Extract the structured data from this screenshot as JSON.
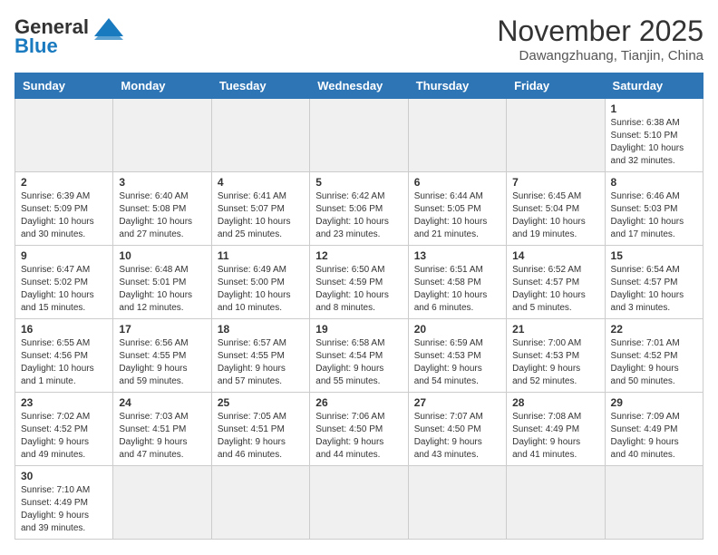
{
  "header": {
    "logo_general": "General",
    "logo_blue": "Blue",
    "month": "November 2025",
    "location": "Dawangzhuang, Tianjin, China"
  },
  "weekdays": [
    "Sunday",
    "Monday",
    "Tuesday",
    "Wednesday",
    "Thursday",
    "Friday",
    "Saturday"
  ],
  "weeks": [
    [
      {
        "day": "",
        "info": ""
      },
      {
        "day": "",
        "info": ""
      },
      {
        "day": "",
        "info": ""
      },
      {
        "day": "",
        "info": ""
      },
      {
        "day": "",
        "info": ""
      },
      {
        "day": "",
        "info": ""
      },
      {
        "day": "1",
        "info": "Sunrise: 6:38 AM\nSunset: 5:10 PM\nDaylight: 10 hours\nand 32 minutes."
      }
    ],
    [
      {
        "day": "2",
        "info": "Sunrise: 6:39 AM\nSunset: 5:09 PM\nDaylight: 10 hours\nand 30 minutes."
      },
      {
        "day": "3",
        "info": "Sunrise: 6:40 AM\nSunset: 5:08 PM\nDaylight: 10 hours\nand 27 minutes."
      },
      {
        "day": "4",
        "info": "Sunrise: 6:41 AM\nSunset: 5:07 PM\nDaylight: 10 hours\nand 25 minutes."
      },
      {
        "day": "5",
        "info": "Sunrise: 6:42 AM\nSunset: 5:06 PM\nDaylight: 10 hours\nand 23 minutes."
      },
      {
        "day": "6",
        "info": "Sunrise: 6:44 AM\nSunset: 5:05 PM\nDaylight: 10 hours\nand 21 minutes."
      },
      {
        "day": "7",
        "info": "Sunrise: 6:45 AM\nSunset: 5:04 PM\nDaylight: 10 hours\nand 19 minutes."
      },
      {
        "day": "8",
        "info": "Sunrise: 6:46 AM\nSunset: 5:03 PM\nDaylight: 10 hours\nand 17 minutes."
      }
    ],
    [
      {
        "day": "9",
        "info": "Sunrise: 6:47 AM\nSunset: 5:02 PM\nDaylight: 10 hours\nand 15 minutes."
      },
      {
        "day": "10",
        "info": "Sunrise: 6:48 AM\nSunset: 5:01 PM\nDaylight: 10 hours\nand 12 minutes."
      },
      {
        "day": "11",
        "info": "Sunrise: 6:49 AM\nSunset: 5:00 PM\nDaylight: 10 hours\nand 10 minutes."
      },
      {
        "day": "12",
        "info": "Sunrise: 6:50 AM\nSunset: 4:59 PM\nDaylight: 10 hours\nand 8 minutes."
      },
      {
        "day": "13",
        "info": "Sunrise: 6:51 AM\nSunset: 4:58 PM\nDaylight: 10 hours\nand 6 minutes."
      },
      {
        "day": "14",
        "info": "Sunrise: 6:52 AM\nSunset: 4:57 PM\nDaylight: 10 hours\nand 5 minutes."
      },
      {
        "day": "15",
        "info": "Sunrise: 6:54 AM\nSunset: 4:57 PM\nDaylight: 10 hours\nand 3 minutes."
      }
    ],
    [
      {
        "day": "16",
        "info": "Sunrise: 6:55 AM\nSunset: 4:56 PM\nDaylight: 10 hours\nand 1 minute."
      },
      {
        "day": "17",
        "info": "Sunrise: 6:56 AM\nSunset: 4:55 PM\nDaylight: 9 hours\nand 59 minutes."
      },
      {
        "day": "18",
        "info": "Sunrise: 6:57 AM\nSunset: 4:55 PM\nDaylight: 9 hours\nand 57 minutes."
      },
      {
        "day": "19",
        "info": "Sunrise: 6:58 AM\nSunset: 4:54 PM\nDaylight: 9 hours\nand 55 minutes."
      },
      {
        "day": "20",
        "info": "Sunrise: 6:59 AM\nSunset: 4:53 PM\nDaylight: 9 hours\nand 54 minutes."
      },
      {
        "day": "21",
        "info": "Sunrise: 7:00 AM\nSunset: 4:53 PM\nDaylight: 9 hours\nand 52 minutes."
      },
      {
        "day": "22",
        "info": "Sunrise: 7:01 AM\nSunset: 4:52 PM\nDaylight: 9 hours\nand 50 minutes."
      }
    ],
    [
      {
        "day": "23",
        "info": "Sunrise: 7:02 AM\nSunset: 4:52 PM\nDaylight: 9 hours\nand 49 minutes."
      },
      {
        "day": "24",
        "info": "Sunrise: 7:03 AM\nSunset: 4:51 PM\nDaylight: 9 hours\nand 47 minutes."
      },
      {
        "day": "25",
        "info": "Sunrise: 7:05 AM\nSunset: 4:51 PM\nDaylight: 9 hours\nand 46 minutes."
      },
      {
        "day": "26",
        "info": "Sunrise: 7:06 AM\nSunset: 4:50 PM\nDaylight: 9 hours\nand 44 minutes."
      },
      {
        "day": "27",
        "info": "Sunrise: 7:07 AM\nSunset: 4:50 PM\nDaylight: 9 hours\nand 43 minutes."
      },
      {
        "day": "28",
        "info": "Sunrise: 7:08 AM\nSunset: 4:49 PM\nDaylight: 9 hours\nand 41 minutes."
      },
      {
        "day": "29",
        "info": "Sunrise: 7:09 AM\nSunset: 4:49 PM\nDaylight: 9 hours\nand 40 minutes."
      }
    ],
    [
      {
        "day": "30",
        "info": "Sunrise: 7:10 AM\nSunset: 4:49 PM\nDaylight: 9 hours\nand 39 minutes."
      },
      {
        "day": "",
        "info": ""
      },
      {
        "day": "",
        "info": ""
      },
      {
        "day": "",
        "info": ""
      },
      {
        "day": "",
        "info": ""
      },
      {
        "day": "",
        "info": ""
      },
      {
        "day": "",
        "info": ""
      }
    ]
  ]
}
